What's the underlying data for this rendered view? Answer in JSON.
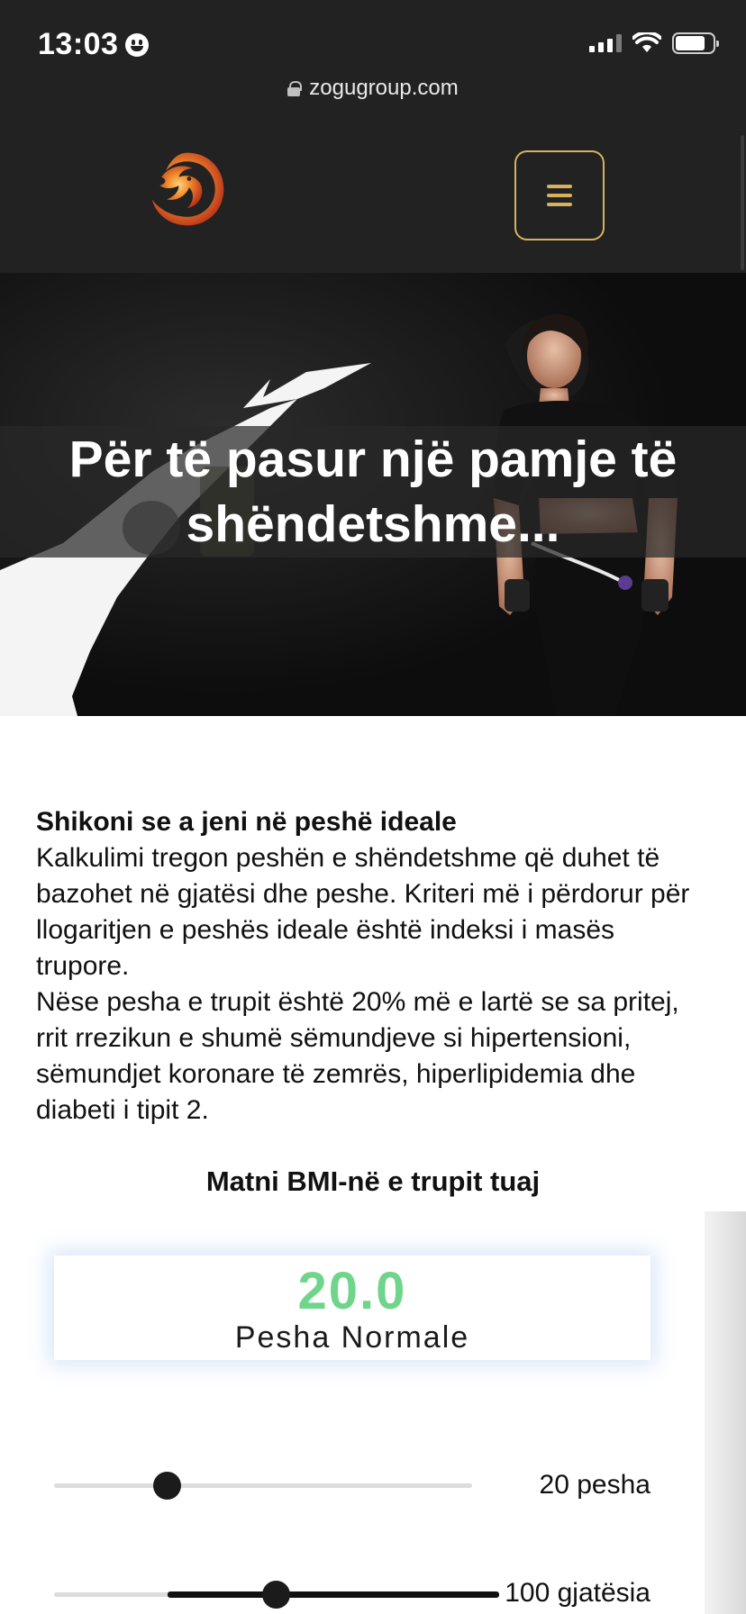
{
  "status_bar": {
    "time": "13:03"
  },
  "browser": {
    "url": "zogugroup.com"
  },
  "header": {
    "logo_alt": "Zogu Group logo",
    "menu_label": "menu"
  },
  "hero": {
    "title": "Për të pasur një pamje të shëndetshme..."
  },
  "intro": {
    "heading": "Shikoni se a jeni në peshë ideale",
    "paragraph1": "Kalkulimi tregon peshën e shëndetshme që duhet të bazohet në gjatësi dhe peshe. Kriteri më i përdorur për llogaritjen e peshës ideale është indeksi i masës trupore.",
    "paragraph2": "Nëse pesha e trupit është 20% më e lartë se sa pritej, rrit rrezikun e shumë sëmundjeve si hipertensioni, sëmundjet koronare të zemrës, hiperlipidemia dhe diabeti i tipit 2."
  },
  "calculator": {
    "title": "Matni BMI-në e trupit tuaj",
    "bmi_value": "20.0",
    "bmi_category": "Pesha Normale",
    "accent_color": "#6fd58a",
    "weight": {
      "value": 20,
      "label": "20 pesha",
      "position": 0.27
    },
    "height": {
      "value": 100,
      "label": "100 gjatësia",
      "position": 0.53
    }
  },
  "colors": {
    "header_bg": "#222222",
    "menu_border": "#d6b25e"
  }
}
